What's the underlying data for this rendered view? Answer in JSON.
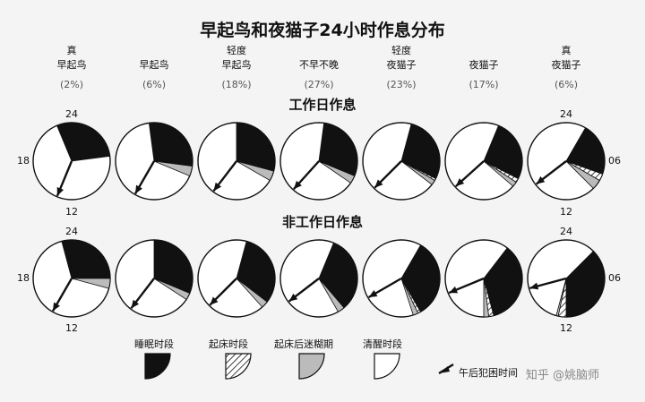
{
  "title": "早起鸟和夜猫子24小时作息分布",
  "categories": [
    {
      "line1": "真",
      "line2": "早起鸟",
      "pct": "(2%)"
    },
    {
      "line1": "",
      "line2": "早起鸟",
      "pct": "(6%)"
    },
    {
      "line1": "轻度",
      "line2": "早起鸟",
      "pct": "(18%)"
    },
    {
      "line1": "",
      "line2": "不早不晚",
      "pct": "(27%)"
    },
    {
      "line1": "轻度",
      "line2": "夜猫子",
      "pct": "(23%)"
    },
    {
      "line1": "",
      "line2": "夜猫子",
      "pct": "(17%)"
    },
    {
      "line1": "真",
      "line2": "夜猫子",
      "pct": "(6%)"
    }
  ],
  "rows": [
    {
      "label": "工作日作息"
    },
    {
      "label": "非工作日作息"
    }
  ],
  "hour_labels": {
    "top": "24",
    "left": "18",
    "bottom": "12",
    "right": "06"
  },
  "colors": {
    "sleep": "#111111",
    "inertia": "#bbbbbb",
    "awake": "#ffffff",
    "line": "#111111",
    "background": "#f4f4f4"
  },
  "legend": [
    {
      "kind": "sleep",
      "label": "睡眠时段"
    },
    {
      "kind": "wake",
      "label": "起床时段"
    },
    {
      "kind": "inertia",
      "label": "起床后迷糊期"
    },
    {
      "kind": "awake",
      "label": "清醒时段"
    },
    {
      "kind": "dip",
      "label": "午后犯困时间"
    }
  ],
  "watermark": "知乎 @姚脑师",
  "chart_data": {
    "type": "clock",
    "note_units": "hours on a 24-hour clock dial",
    "schedules": [
      [
        {
          "sleep": [
            22.5,
            5.5
          ],
          "wake": [
            5.5,
            5.5
          ],
          "inertia": [
            5.5,
            5.5
          ],
          "dip": 13.5
        },
        {
          "sleep": [
            23.5,
            6.5
          ],
          "wake": [
            6.5,
            6.5
          ],
          "inertia": [
            6.5,
            7.5
          ],
          "dip": 14.0
        },
        {
          "sleep": [
            0.0,
            7.0
          ],
          "wake": [
            7.0,
            7.0
          ],
          "inertia": [
            7.0,
            8.0
          ],
          "dip": 14.5
        },
        {
          "sleep": [
            0.5,
            7.5
          ],
          "wake": [
            7.5,
            7.5
          ],
          "inertia": [
            7.5,
            8.3
          ],
          "dip": 14.8
        },
        {
          "sleep": [
            1.0,
            7.8
          ],
          "wake": [
            7.8,
            8.0
          ],
          "inertia": [
            8.0,
            8.5
          ],
          "dip": 15.0
        },
        {
          "sleep": [
            1.5,
            7.8
          ],
          "wake": [
            7.8,
            8.2
          ],
          "inertia": [
            8.2,
            8.7
          ],
          "dip": 15.2
        },
        {
          "sleep": [
            2.0,
            7.3
          ],
          "wake": [
            7.3,
            8.0
          ],
          "inertia": [
            8.0,
            9.0
          ],
          "dip": 15.5
        }
      ],
      [
        {
          "sleep": [
            23.0,
            6.0
          ],
          "wake": [
            6.0,
            6.0
          ],
          "inertia": [
            6.0,
            7.0
          ],
          "dip": 14.0
        },
        {
          "sleep": [
            0.0,
            7.5
          ],
          "wake": [
            7.5,
            7.5
          ],
          "inertia": [
            7.5,
            8.2
          ],
          "dip": 14.5
        },
        {
          "sleep": [
            1.0,
            8.5
          ],
          "wake": [
            8.5,
            8.5
          ],
          "inertia": [
            8.5,
            9.2
          ],
          "dip": 15.0
        },
        {
          "sleep": [
            1.5,
            9.3
          ],
          "wake": [
            9.3,
            9.3
          ],
          "inertia": [
            9.3,
            10.0
          ],
          "dip": 15.5
        },
        {
          "sleep": [
            2.0,
            10.0
          ],
          "wake": [
            10.0,
            10.3
          ],
          "inertia": [
            10.3,
            10.8
          ],
          "dip": 16.0
        },
        {
          "sleep": [
            2.5,
            11.0
          ],
          "wake": [
            11.0,
            11.5
          ],
          "inertia": [
            11.5,
            12.0
          ],
          "dip": 16.5
        },
        {
          "sleep": [
            3.0,
            12.0
          ],
          "wake": [
            12.0,
            12.8
          ],
          "inertia": [
            12.8,
            13.0
          ],
          "dip": 17.0
        }
      ]
    ]
  }
}
